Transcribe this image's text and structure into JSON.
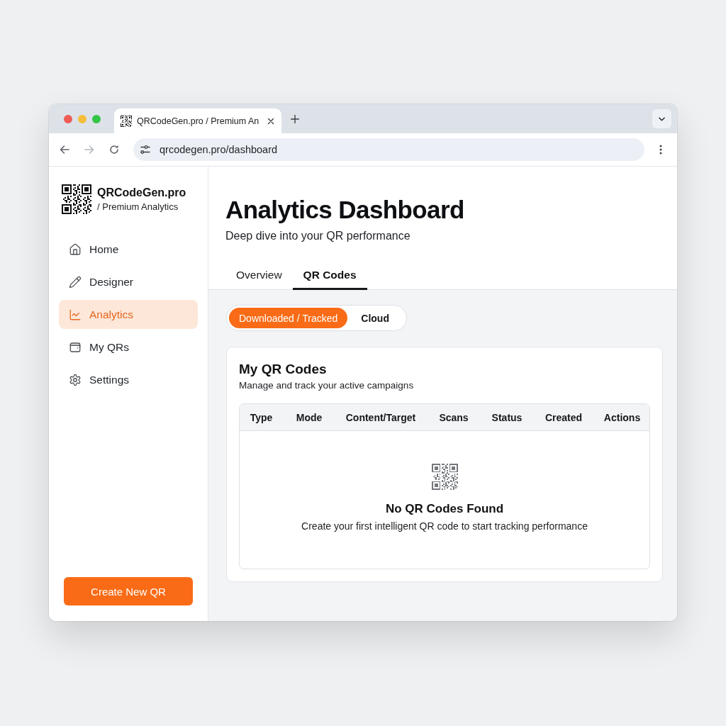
{
  "browser": {
    "tab": {
      "title": "QRCodeGen.pro / Premium An"
    },
    "forward_disabled": true,
    "address": "qrcodegen.pro/dashboard"
  },
  "sidebar": {
    "brand": {
      "name": "QRCodeGen.pro",
      "tagline": "/ Premium Analytics"
    },
    "items": [
      {
        "label": "Home",
        "selected": false
      },
      {
        "label": "Designer",
        "selected": false
      },
      {
        "label": "Analytics",
        "selected": true
      },
      {
        "label": "My QRs",
        "selected": false
      },
      {
        "label": "Settings",
        "selected": false
      }
    ],
    "create_button": "Create New QR"
  },
  "header": {
    "title": "Analytics Dashboard",
    "subtitle": "Deep dive into your QR performance",
    "tabs": [
      {
        "label": "Overview",
        "selected": false
      },
      {
        "label": "QR Codes",
        "selected": true
      }
    ]
  },
  "source_filter": [
    {
      "label": "Downloaded / Tracked",
      "selected": true
    },
    {
      "label": "Cloud",
      "selected": false
    }
  ],
  "qr_codes_card": {
    "title": "My QR Codes",
    "subtitle": "Manage and track your active campaigns",
    "table": {
      "columns": [
        "Type",
        "Mode",
        "Content/Target",
        "Scans",
        "Status",
        "Created",
        "Actions"
      ]
    },
    "empty_state": {
      "title": "No QR Codes Found",
      "message": "Create your first intelligent QR code to start tracking performance"
    }
  }
}
